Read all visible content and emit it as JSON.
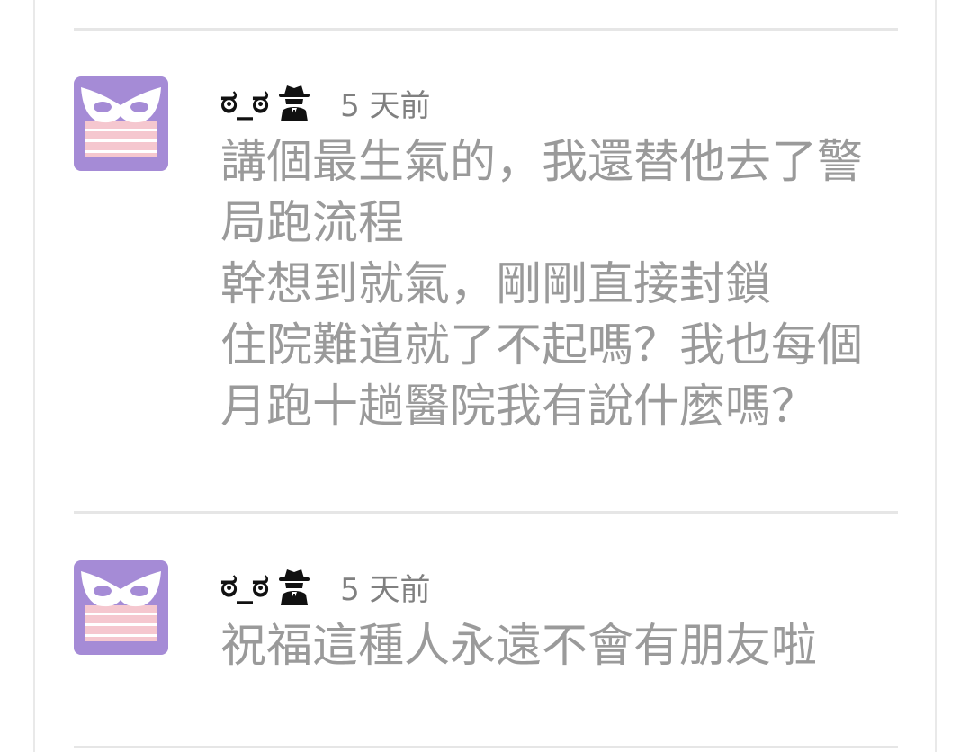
{
  "comments": [
    {
      "username": "ಠ_ಠ",
      "time": "5 天前",
      "avatar_icon": "mask-avatar-icon",
      "badge_icon": "spy-icon",
      "text": "講個最生氣的，我還替他去了警\n局跑流程\n幹想到就氣，剛剛直接封鎖\n住院難道就了不起嗎？我也每個\n月跑十趟醫院我有說什麼嗎？"
    },
    {
      "username": "ಠ_ಠ",
      "time": "5 天前",
      "avatar_icon": "mask-avatar-icon",
      "badge_icon": "spy-icon",
      "text": "祝福這種人永遠不會有朋友啦"
    }
  ],
  "colors": {
    "avatar_bg": "#a58bd6",
    "mask": "#ffffff",
    "band_pink": "#f5c7cf",
    "text_gray": "#9a9a9a",
    "time_gray": "#808080",
    "divider": "#e6e6e6"
  }
}
